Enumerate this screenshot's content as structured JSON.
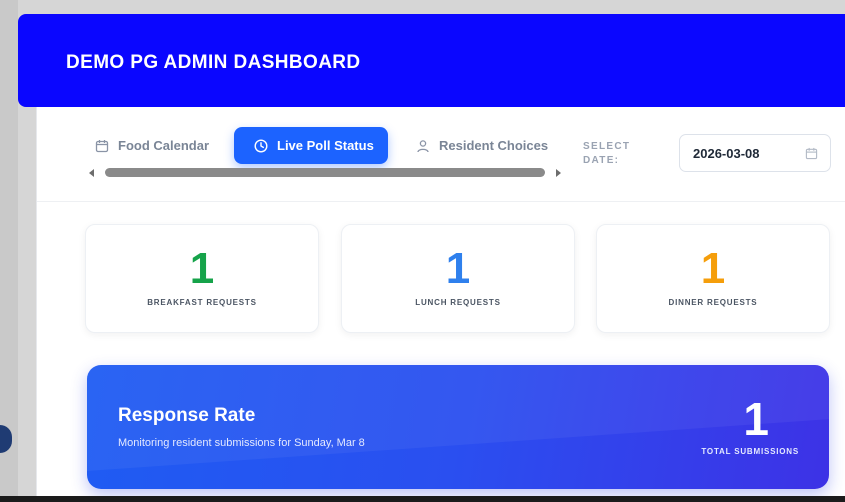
{
  "header": {
    "title": "DEMO PG ADMIN DASHBOARD",
    "bg_color": "#0a06ff"
  },
  "tabs": [
    {
      "label": "Food Calendar",
      "icon": "calendar-icon",
      "active": false
    },
    {
      "label": "Live Poll Status",
      "icon": "clock-icon",
      "active": true
    },
    {
      "label": "Resident Choices",
      "icon": "user-icon",
      "active": false
    }
  ],
  "date_picker": {
    "label": "SELECT DATE:",
    "value": "2026-03-08",
    "icon": "calendar-icon"
  },
  "stats": [
    {
      "value": "1",
      "label": "BREAKFAST REQUESTS",
      "color": "#16a34a"
    },
    {
      "value": "1",
      "label": "LUNCH REQUESTS",
      "color": "#2f80ed"
    },
    {
      "value": "1",
      "label": "DINNER REQUESTS",
      "color": "#f59e0b"
    }
  ],
  "response": {
    "title": "Response Rate",
    "subtitle": "Monitoring resident submissions for Sunday, Mar 8",
    "total": "1",
    "total_label": "TOTAL SUBMISSIONS"
  },
  "colors": {
    "accent": "#1c63ff",
    "text_muted": "#7a8596"
  }
}
